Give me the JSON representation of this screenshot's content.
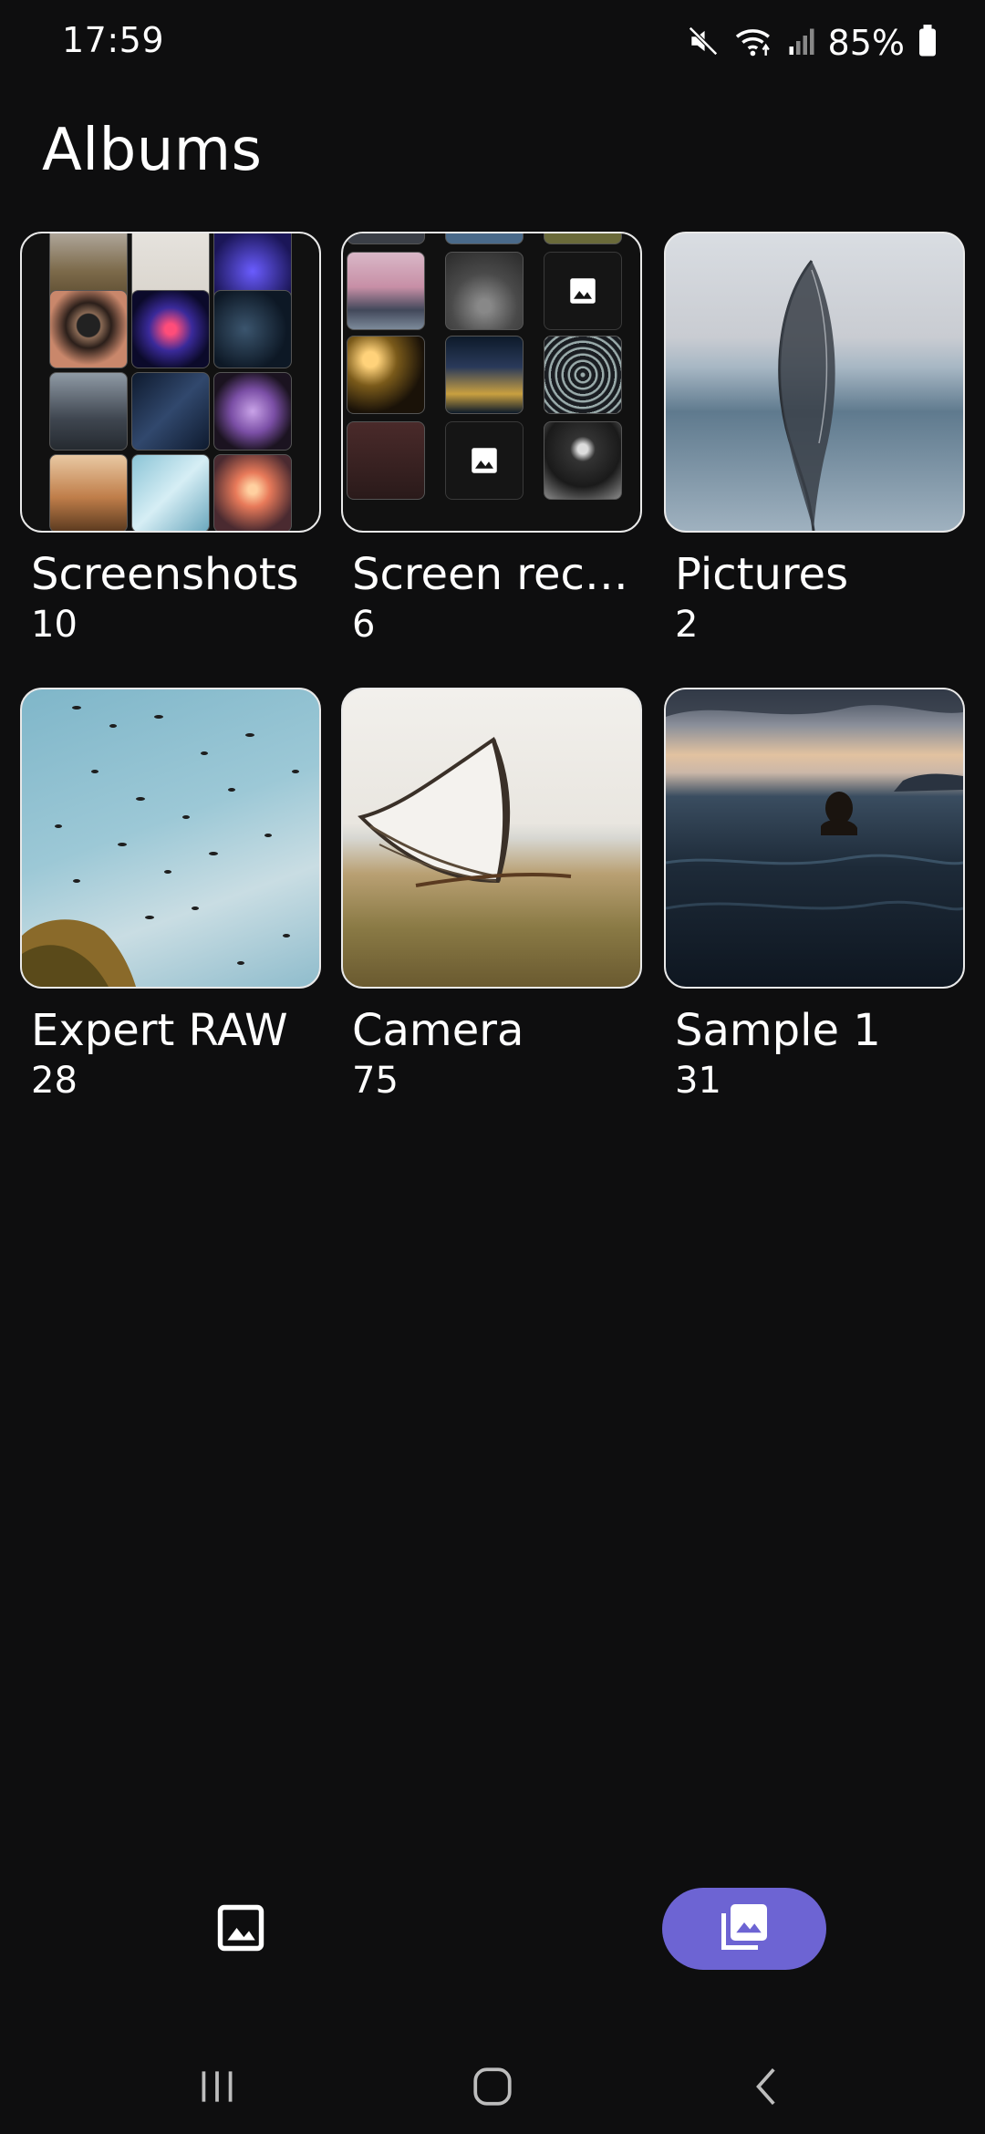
{
  "status_bar": {
    "time": "17:59",
    "battery_percent": "85%",
    "icons": [
      "mute-icon",
      "wifi-icon",
      "signal-icon",
      "battery-icon"
    ]
  },
  "header": {
    "title": "Albums"
  },
  "albums": [
    {
      "name": "Screenshots",
      "count": "10"
    },
    {
      "name": "Screen reco...",
      "count": "6"
    },
    {
      "name": "Pictures",
      "count": "2"
    },
    {
      "name": "Expert RAW",
      "count": "28"
    },
    {
      "name": "Camera",
      "count": "75"
    },
    {
      "name": "Sample 1",
      "count": "31"
    }
  ],
  "bottom_tabs": [
    {
      "name": "pictures-tab",
      "icon": "image-icon",
      "selected": false
    },
    {
      "name": "albums-tab",
      "icon": "albums-icon",
      "selected": true
    }
  ],
  "colors": {
    "background": "#0e0e0f",
    "accent": "#6d64d3",
    "text": "#ffffff"
  },
  "nav_bar": {
    "icons": [
      "recents-icon",
      "home-icon",
      "back-icon"
    ]
  }
}
